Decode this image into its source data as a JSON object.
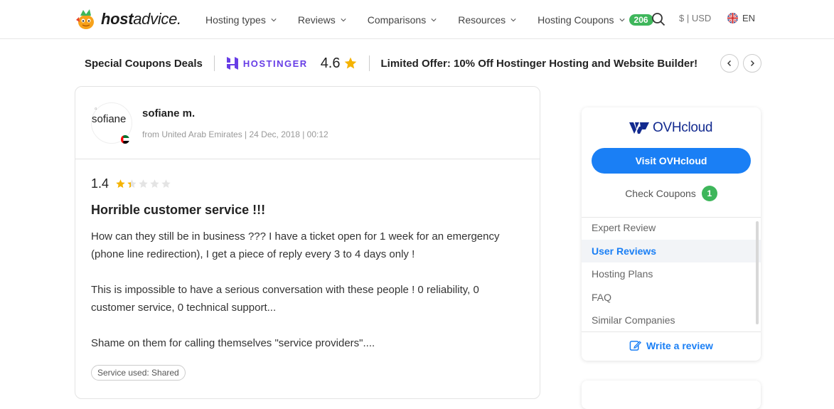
{
  "header": {
    "logo_text": "hostadvice.",
    "nav": [
      {
        "label": "Hosting types"
      },
      {
        "label": "Reviews"
      },
      {
        "label": "Comparisons"
      },
      {
        "label": "Resources"
      },
      {
        "label": "Hosting Coupons",
        "badge": "206"
      }
    ],
    "currency": "$ | USD",
    "language": "EN"
  },
  "coupon_strip": {
    "title": "Special Coupons Deals",
    "brand": "HOSTINGER",
    "rating": "4.6",
    "offer": "Limited Offer: 10% Off Hostinger Hosting and Website Builder!",
    "prev_icon": "chevron-left-icon",
    "next_icon": "chevron-right-icon"
  },
  "review": {
    "reviewer_name": "sofiane m.",
    "avatar_alt": "sofiane",
    "meta": "from United Arab Emirates | 24 Dec, 2018 | 00:12",
    "score": "1.4",
    "stars_filled": 1.4,
    "stars_total": 5,
    "title": "Horrible customer service !!!",
    "paragraphs": [
      "How can they still be in business ??? I have a ticket open for 1 week for an emergency (phone line redirection), I get a piece of reply every 3 to 4 days only !",
      "This is impossible to have a serious conversation with these people ! 0 reliability, 0 customer service, 0 technical support...",
      "Shame on them for calling themselves \"service providers\"...."
    ],
    "service_tag": "Service used: Shared"
  },
  "sidebar": {
    "brand": "OVHcloud",
    "visit_label": "Visit OVHcloud",
    "coupons_label": "Check Coupons",
    "coupons_count": "1",
    "menu": [
      {
        "label": "Expert Review",
        "active": false
      },
      {
        "label": "User Reviews",
        "active": true
      },
      {
        "label": "Hosting Plans",
        "active": false
      },
      {
        "label": "FAQ",
        "active": false
      },
      {
        "label": "Similar Companies",
        "active": false
      }
    ],
    "write_review_label": "Write a review"
  },
  "colors": {
    "accent_blue": "#1a7ff5",
    "green_badge": "#3eb65b",
    "star_gold": "#f5b301",
    "hostinger_purple": "#673de6",
    "ovh_navy": "#122a8f"
  }
}
